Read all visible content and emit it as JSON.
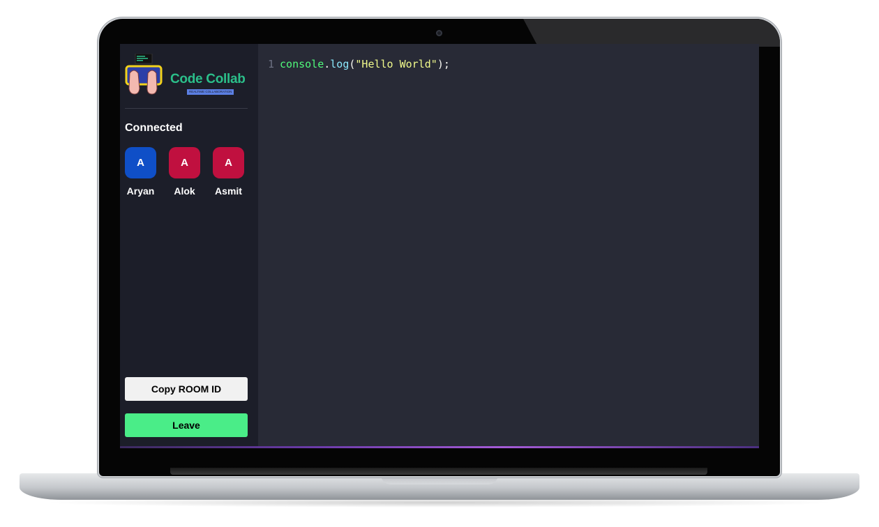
{
  "app": {
    "brand_name": "Code Collab",
    "brand_tagline": "REALTIME COLLABORATION"
  },
  "sidebar": {
    "connected_label": "Connected",
    "clients": [
      {
        "initial": "A",
        "name": "Aryan",
        "color": "#0f4fc7"
      },
      {
        "initial": "A",
        "name": "Alok",
        "color": "#c0103f"
      },
      {
        "initial": "A",
        "name": "Asmit",
        "color": "#c0103f"
      }
    ],
    "copy_room_label": "Copy ROOM ID",
    "leave_label": "Leave"
  },
  "editor": {
    "line_number": "1",
    "tokens": {
      "object": "console",
      "dot": ".",
      "method": "log",
      "open": "(",
      "string": "\"Hello World\"",
      "close": ");"
    }
  },
  "colors": {
    "accent_green": "#4aed88",
    "sidebar_bg": "#1c1e29",
    "editor_bg": "#282a36"
  }
}
